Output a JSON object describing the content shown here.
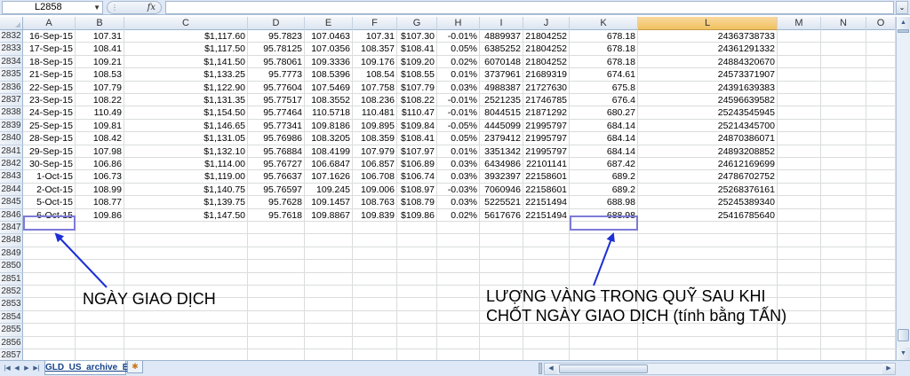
{
  "formula_bar": {
    "name_box": "L2858",
    "fx_label": "fx",
    "formula": ""
  },
  "columns": [
    "A",
    "B",
    "C",
    "D",
    "E",
    "F",
    "G",
    "H",
    "I",
    "J",
    "K",
    "L",
    "M",
    "N",
    "O"
  ],
  "selected_column": "L",
  "rows": [
    {
      "n": "2832",
      "cells": [
        "16-Sep-15",
        "107.31",
        "$1,117.60",
        "95.7823",
        "107.0463",
        "107.31",
        "$107.30",
        "-0.01%",
        "4889937",
        "21804252",
        "678.18",
        "24363738733"
      ]
    },
    {
      "n": "2833",
      "cells": [
        "17-Sep-15",
        "108.41",
        "$1,117.50",
        "95.78125",
        "107.0356",
        "108.357",
        "$108.41",
        "0.05%",
        "6385252",
        "21804252",
        "678.18",
        "24361291332"
      ]
    },
    {
      "n": "2834",
      "cells": [
        "18-Sep-15",
        "109.21",
        "$1,141.50",
        "95.78061",
        "109.3336",
        "109.176",
        "$109.20",
        "0.02%",
        "6070148",
        "21804252",
        "678.18",
        "24884320670"
      ]
    },
    {
      "n": "2835",
      "cells": [
        "21-Sep-15",
        "108.53",
        "$1,133.25",
        "95.7773",
        "108.5396",
        "108.54",
        "$108.55",
        "0.01%",
        "3737961",
        "21689319",
        "674.61",
        "24573371907"
      ]
    },
    {
      "n": "2836",
      "cells": [
        "22-Sep-15",
        "107.79",
        "$1,122.90",
        "95.77604",
        "107.5469",
        "107.758",
        "$107.79",
        "0.03%",
        "4988387",
        "21727630",
        "675.8",
        "24391639383"
      ]
    },
    {
      "n": "2837",
      "cells": [
        "23-Sep-15",
        "108.22",
        "$1,131.35",
        "95.77517",
        "108.3552",
        "108.236",
        "$108.22",
        "-0.01%",
        "2521235",
        "21746785",
        "676.4",
        "24596639582"
      ]
    },
    {
      "n": "2838",
      "cells": [
        "24-Sep-15",
        "110.49",
        "$1,154.50",
        "95.77464",
        "110.5718",
        "110.481",
        "$110.47",
        "-0.01%",
        "8044515",
        "21871292",
        "680.27",
        "25243545945"
      ]
    },
    {
      "n": "2839",
      "cells": [
        "25-Sep-15",
        "109.81",
        "$1,146.65",
        "95.77341",
        "109.8186",
        "109.895",
        "$109.84",
        "-0.05%",
        "4445099",
        "21995797",
        "684.14",
        "25214345700"
      ]
    },
    {
      "n": "2840",
      "cells": [
        "28-Sep-15",
        "108.42",
        "$1,131.05",
        "95.76986",
        "108.3205",
        "108.359",
        "$108.41",
        "0.05%",
        "2379412",
        "21995797",
        "684.14",
        "24870386071"
      ]
    },
    {
      "n": "2841",
      "cells": [
        "29-Sep-15",
        "107.98",
        "$1,132.10",
        "95.76884",
        "108.4199",
        "107.979",
        "$107.97",
        "0.01%",
        "3351342",
        "21995797",
        "684.14",
        "24893208852"
      ]
    },
    {
      "n": "2842",
      "cells": [
        "30-Sep-15",
        "106.86",
        "$1,114.00",
        "95.76727",
        "106.6847",
        "106.857",
        "$106.89",
        "0.03%",
        "6434986",
        "22101141",
        "687.42",
        "24612169699"
      ]
    },
    {
      "n": "2843",
      "cells": [
        "1-Oct-15",
        "106.73",
        "$1,119.00",
        "95.76637",
        "107.1626",
        "106.708",
        "$106.74",
        "0.03%",
        "3932397",
        "22158601",
        "689.2",
        "24786702752"
      ]
    },
    {
      "n": "2844",
      "cells": [
        "2-Oct-15",
        "108.99",
        "$1,140.75",
        "95.76597",
        "109.245",
        "109.006",
        "$108.97",
        "-0.03%",
        "7060946",
        "22158601",
        "689.2",
        "25268376161"
      ]
    },
    {
      "n": "2845",
      "cells": [
        "5-Oct-15",
        "108.77",
        "$1,139.75",
        "95.7628",
        "109.1457",
        "108.763",
        "$108.79",
        "0.03%",
        "5225521",
        "22151494",
        "688.98",
        "25245389340"
      ]
    },
    {
      "n": "2846",
      "cells": [
        "6-Oct-15",
        "109.86",
        "$1,147.50",
        "95.7618",
        "109.8867",
        "109.839",
        "$109.86",
        "0.02%",
        "5617676",
        "22151494",
        "688.98",
        "25416785640"
      ]
    },
    {
      "n": "2847",
      "cells": []
    },
    {
      "n": "2848",
      "cells": []
    },
    {
      "n": "2849",
      "cells": []
    },
    {
      "n": "2850",
      "cells": []
    },
    {
      "n": "2851",
      "cells": []
    },
    {
      "n": "2852",
      "cells": []
    },
    {
      "n": "2853",
      "cells": []
    },
    {
      "n": "2854",
      "cells": []
    },
    {
      "n": "2855",
      "cells": []
    },
    {
      "n": "2856",
      "cells": []
    },
    {
      "n": "2857",
      "cells": []
    }
  ],
  "annotations": {
    "date_label": "NGÀY GIAO DỊCH",
    "gold_label_line1": "LƯỢNG VÀNG TRONG QUỸ SAU KHI",
    "gold_label_line2": "CHỐT NGÀY GIAO DỊCH (tính bằng TẤN)"
  },
  "sheet_tabs": [
    {
      "label": "GLD_US_archive_EN",
      "active": true
    }
  ],
  "colors": {
    "highlight_border": "#7e7bd8",
    "arrow": "#1c2fd6",
    "selected_header": "#f1c15f"
  }
}
